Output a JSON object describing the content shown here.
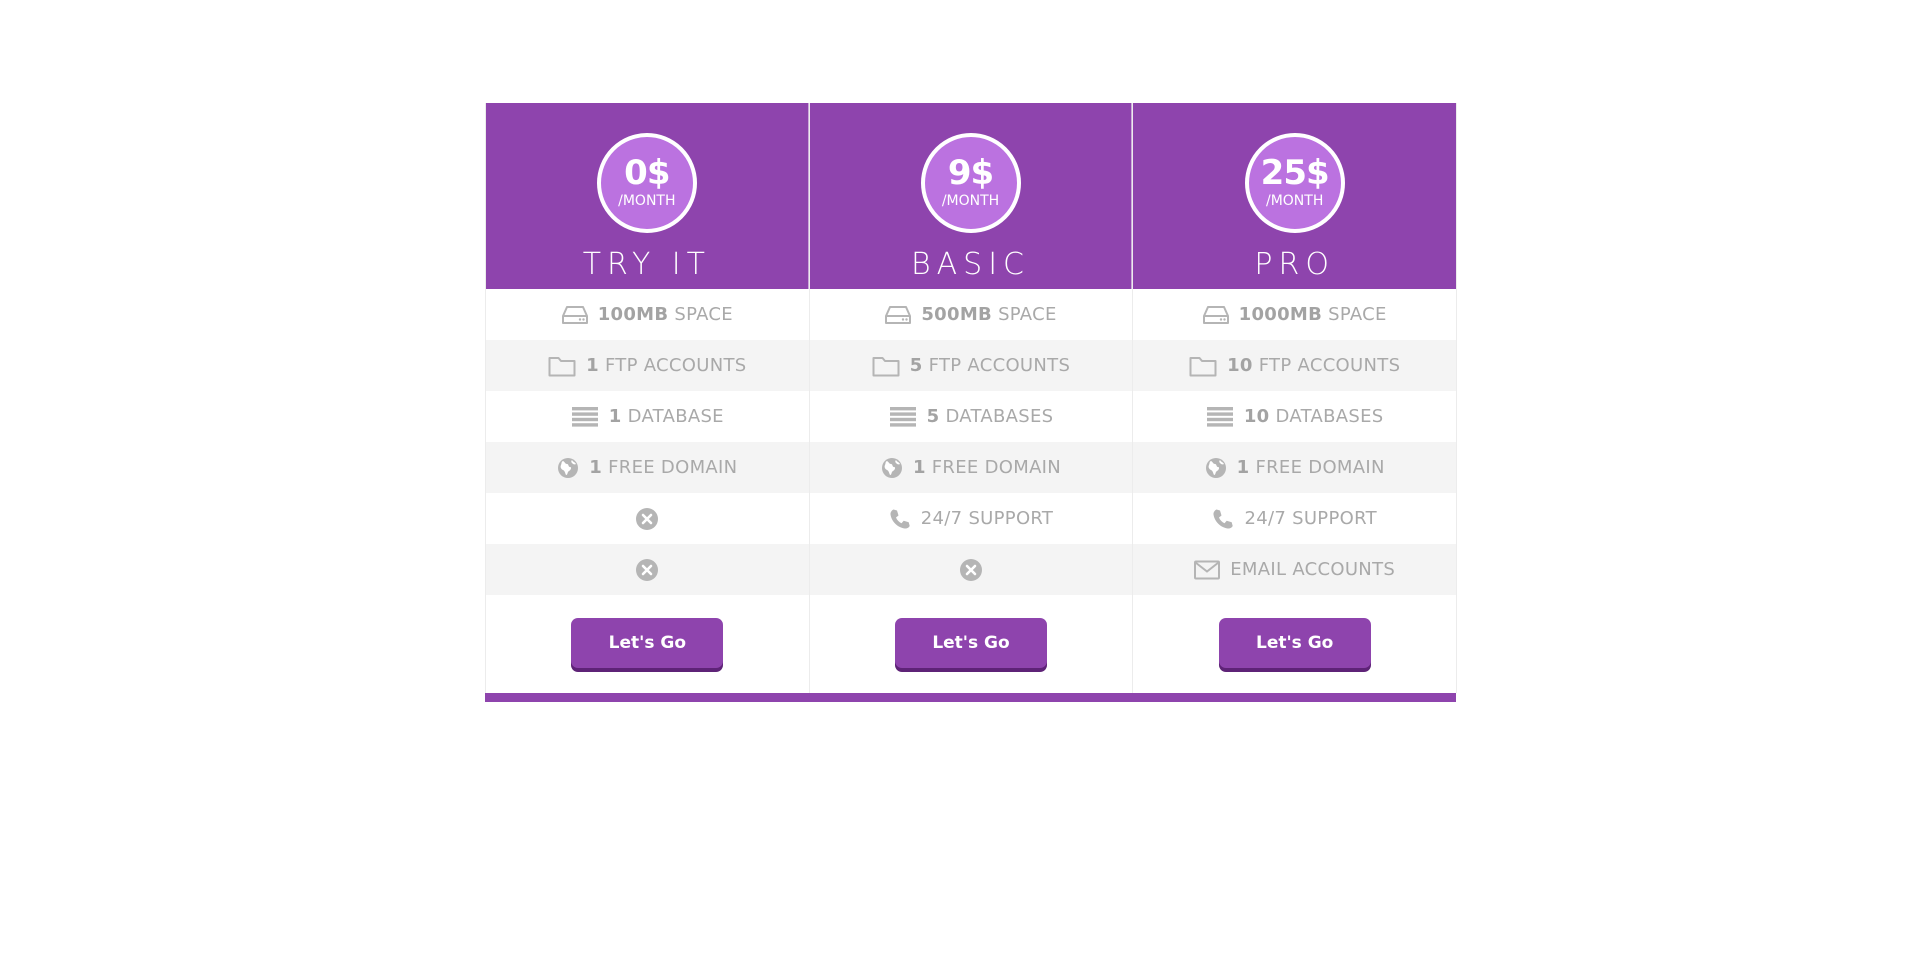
{
  "plans": [
    {
      "price": "0$",
      "period": "/MONTH",
      "name": "TRY IT",
      "features": [
        {
          "icon": "hdd-icon",
          "strong": "100MB",
          "text": "SPACE"
        },
        {
          "icon": "folder-icon",
          "strong": "1",
          "text": "FTP ACCOUNTS"
        },
        {
          "icon": "database-icon",
          "strong": "1",
          "text": "DATABASE"
        },
        {
          "icon": "globe-icon",
          "strong": "1",
          "text": "FREE DOMAIN"
        },
        {
          "icon": "not-included-icon",
          "strong": "",
          "text": ""
        },
        {
          "icon": "not-included-icon",
          "strong": "",
          "text": ""
        }
      ],
      "button_label": "Let's Go"
    },
    {
      "price": "9$",
      "period": "/MONTH",
      "name": "BASIC",
      "features": [
        {
          "icon": "hdd-icon",
          "strong": "500MB",
          "text": "SPACE"
        },
        {
          "icon": "folder-icon",
          "strong": "5",
          "text": "FTP ACCOUNTS"
        },
        {
          "icon": "database-icon",
          "strong": "5",
          "text": "DATABASES"
        },
        {
          "icon": "globe-icon",
          "strong": "1",
          "text": "FREE DOMAIN"
        },
        {
          "icon": "phone-icon",
          "strong": "",
          "text": "24/7 SUPPORT"
        },
        {
          "icon": "not-included-icon",
          "strong": "",
          "text": ""
        }
      ],
      "button_label": "Let's Go"
    },
    {
      "price": "25$",
      "period": "/MONTH",
      "name": "PRO",
      "features": [
        {
          "icon": "hdd-icon",
          "strong": "1000MB",
          "text": "SPACE"
        },
        {
          "icon": "folder-icon",
          "strong": "10",
          "text": "FTP ACCOUNTS"
        },
        {
          "icon": "database-icon",
          "strong": "10",
          "text": "DATABASES"
        },
        {
          "icon": "globe-icon",
          "strong": "1",
          "text": "FREE DOMAIN"
        },
        {
          "icon": "phone-icon",
          "strong": "",
          "text": "24/7 SUPPORT"
        },
        {
          "icon": "envelope-icon",
          "strong": "",
          "text": "EMAIL ACCOUNTS"
        }
      ],
      "button_label": "Let's Go"
    }
  ],
  "colors": {
    "brand": "#8e44ad",
    "price_circle": "#bb72e0",
    "button_shadow": "#5e2377",
    "feature_text": "#a9a9a9",
    "alt_row": "#f4f4f4"
  }
}
